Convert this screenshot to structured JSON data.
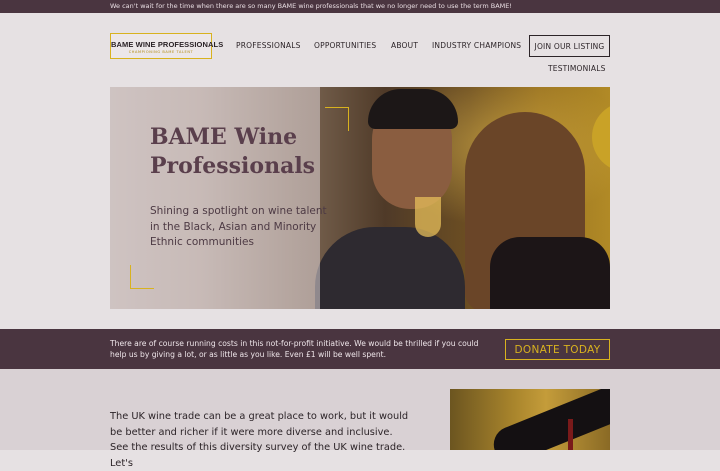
{
  "announcement": "We can't wait for the time when there are so many BAME wine professionals that we no longer need to use the term BAME!",
  "logo": {
    "title": "BAME WINE PROFESSIONALS",
    "tagline": "CHAMPIONING BAME TALENT"
  },
  "nav": {
    "items": [
      "PROFESSIONALS",
      "OPPORTUNITIES",
      "ABOUT",
      "INDUSTRY CHAMPIONS"
    ],
    "join": "JOIN OUR LISTING",
    "testimonials": "TESTIMONIALS"
  },
  "hero": {
    "title": "BAME Wine Professionals",
    "subtitle": "Shining a spotlight on wine talent in the Black, Asian and Minority Ethnic communities"
  },
  "donate": {
    "text": "There are of course running costs in this not-for-profit initiative. We would be thrilled if you could help us by giving a lot, or as little as you like. Even £1 will be well spent.",
    "button": "DONATE TODAY"
  },
  "intro": {
    "text": "The UK wine trade can be a great place to work, but it would be better and richer if it were more diverse and inclusive. See the results of this diversity survey of the UK wine trade. Let's"
  },
  "colors": {
    "accent": "#d8b21f",
    "band": "#4a3540",
    "background": "#e6e1e3"
  }
}
